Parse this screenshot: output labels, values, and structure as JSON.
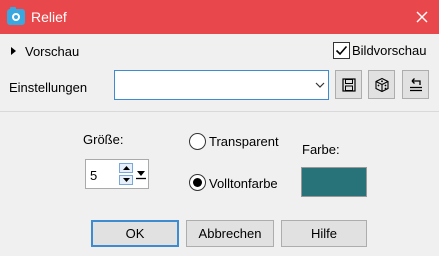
{
  "window": {
    "title": "Relief"
  },
  "preview": {
    "label": "Vorschau",
    "bild_label": "Bildvorschau",
    "bild_checked": true
  },
  "settings": {
    "label": "Einstellungen",
    "value": ""
  },
  "size": {
    "label": "Größe:",
    "value": "5"
  },
  "fill_mode": {
    "options": [
      {
        "label": "Transparent",
        "checked": false
      },
      {
        "label": "Volltonfarbe",
        "checked": true
      }
    ]
  },
  "color": {
    "label": "Farbe:",
    "swatch": "#287279"
  },
  "buttons": {
    "ok": "OK",
    "cancel": "Abbrechen",
    "help": "Hilfe"
  },
  "colors": {
    "title_bar": "#e8484b",
    "focus": "#3c8ccf"
  }
}
